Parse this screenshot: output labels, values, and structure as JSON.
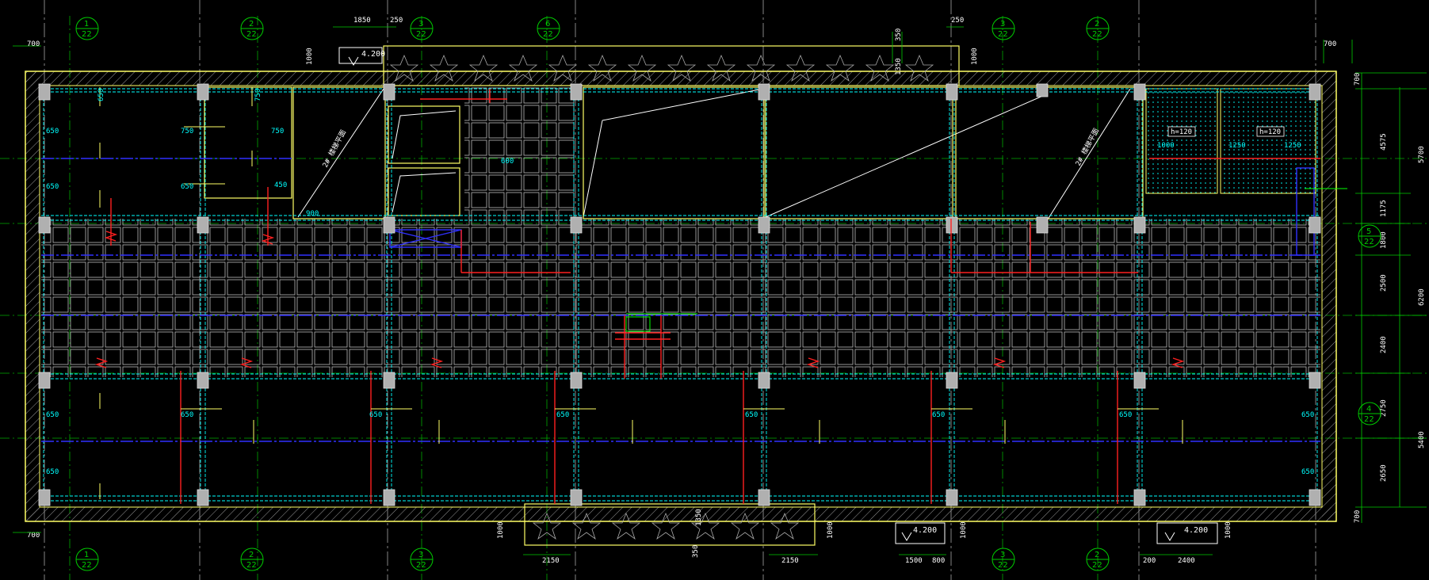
{
  "drawing": {
    "colors": {
      "background": "#000000",
      "wall_outline": "#ffff66",
      "slab_grid": "#ffffff",
      "beam_cyan": "#00ffff",
      "axis_green": "#00cc00",
      "rebar_red": "#ff2020",
      "centerline_blue": "#2020ff",
      "column_gray": "#b0b0b0"
    },
    "top_dims": [
      "1850",
      "250",
      "250",
      "350",
      "1350",
      "1000",
      "1000",
      "700",
      "700"
    ],
    "left_dims": [
      "700",
      "700"
    ],
    "right_dims": [
      "700",
      "4575",
      "5700",
      "1175",
      "1800",
      "2500",
      "6200",
      "2400",
      "2750",
      "5400",
      "2650",
      "700"
    ],
    "bottom_dims": [
      "1000",
      "2150",
      "350",
      "2150",
      "1000",
      "1350",
      "1500",
      "800",
      "1000",
      "200",
      "2400",
      "1000"
    ],
    "elevation_marks": [
      "4.200",
      "4.200",
      "4.200"
    ],
    "axis_bubbles_top": [
      {
        "num": "1",
        "ref": "22"
      },
      {
        "num": "2",
        "ref": "22"
      },
      {
        "num": "3",
        "ref": "22"
      },
      {
        "num": "6",
        "ref": "22"
      },
      {
        "num": "3",
        "ref": "22"
      },
      {
        "num": "2",
        "ref": "22"
      }
    ],
    "axis_bubbles_bottom": [
      {
        "num": "1",
        "ref": "22"
      },
      {
        "num": "2",
        "ref": "22"
      },
      {
        "num": "3",
        "ref": "22"
      },
      {
        "num": "3",
        "ref": "22"
      },
      {
        "num": "2",
        "ref": "22"
      }
    ],
    "axis_bubbles_right": [
      {
        "num": "5",
        "ref": "22"
      },
      {
        "num": "4",
        "ref": "22"
      }
    ],
    "rebar_labels": [
      "650",
      "750",
      "450",
      "600",
      "1000",
      "1250",
      "900"
    ],
    "slab_tags": [
      "h=120",
      "h=120"
    ],
    "stair_labels": [
      "2# 楼梯平面",
      "2# 楼梯平面"
    ]
  }
}
